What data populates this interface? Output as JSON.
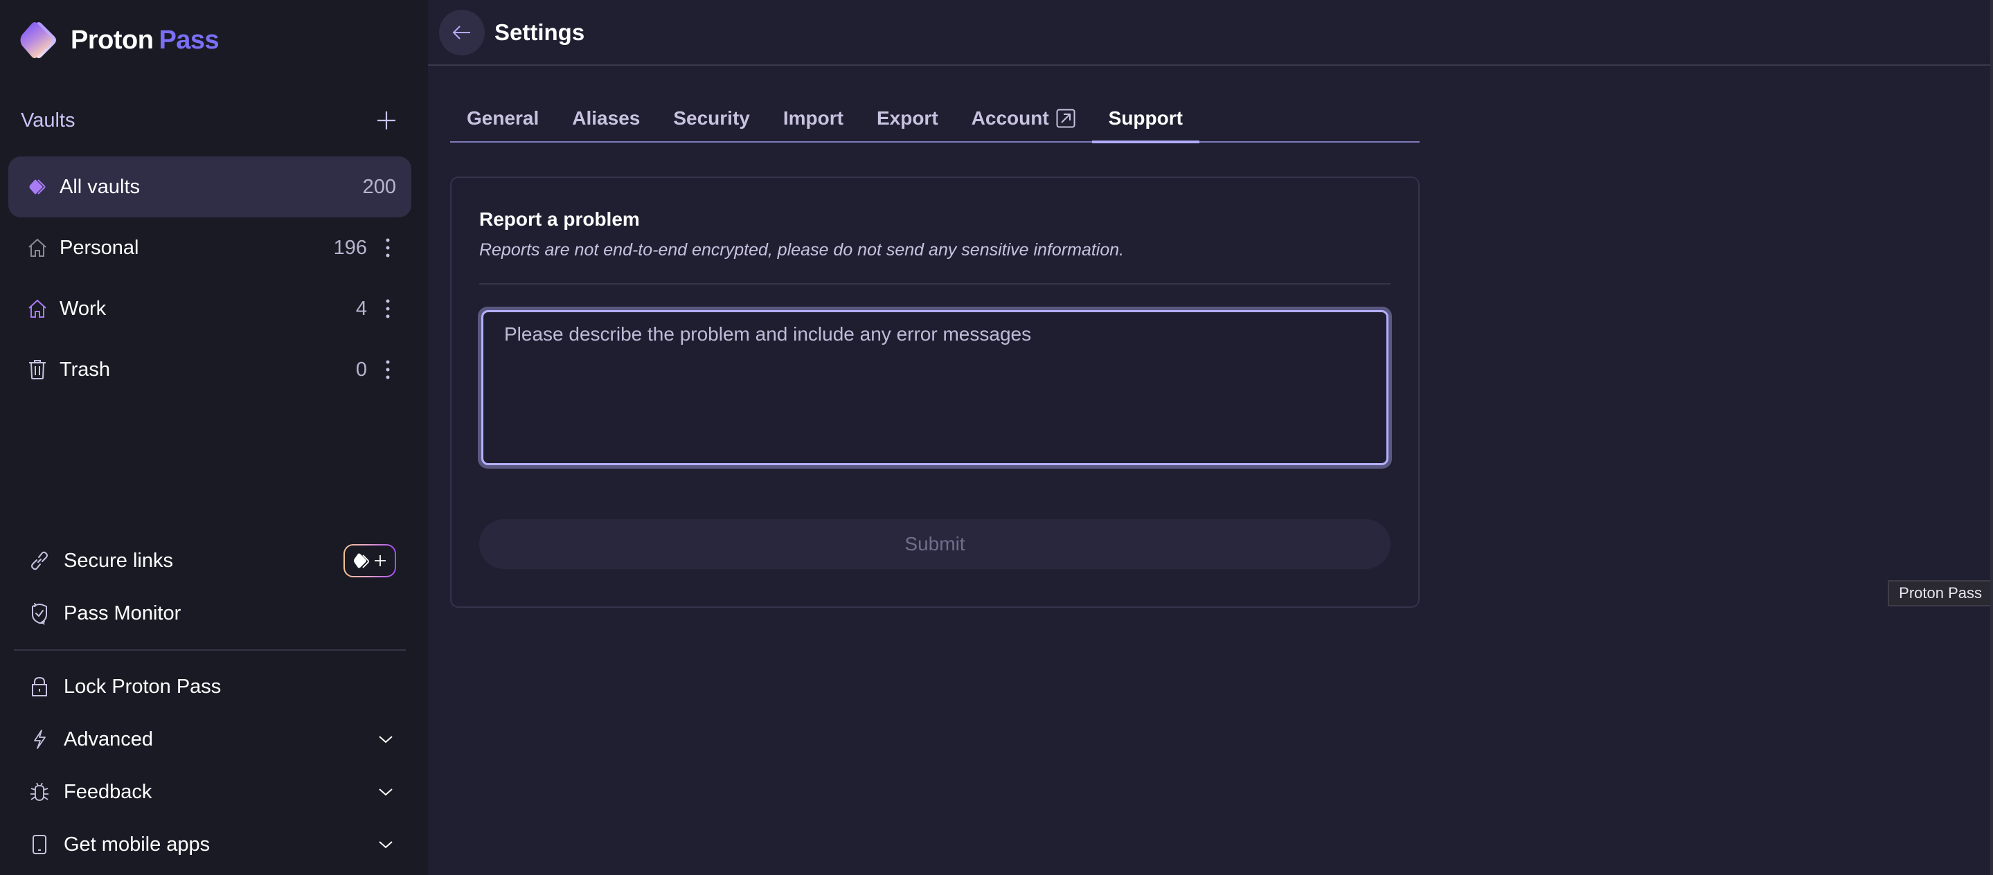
{
  "app": {
    "name_part1": "Proton",
    "name_part2": "Pass",
    "brand_color": "#7b6ff5"
  },
  "sidebar": {
    "vaults_label": "Vaults",
    "add_vault_icon": "plus-icon",
    "vaults": [
      {
        "label": "All vaults",
        "count": "200",
        "icon": "all-vaults-icon",
        "active": true
      },
      {
        "label": "Personal",
        "count": "196",
        "icon": "home-icon",
        "icon_color": "#8a8897"
      },
      {
        "label": "Work",
        "count": "4",
        "icon": "home-icon",
        "icon_color": "#a77cf5"
      },
      {
        "label": "Trash",
        "count": "0",
        "icon": "trash-icon"
      }
    ],
    "tools": [
      {
        "label": "Secure links",
        "icon": "link-icon",
        "badge": "upgrade-plus-badge"
      },
      {
        "label": "Pass Monitor",
        "icon": "shield-check-icon"
      }
    ],
    "menu": [
      {
        "label": "Lock Proton Pass",
        "icon": "lock-icon"
      },
      {
        "label": "Advanced",
        "icon": "bolt-icon",
        "expandable": true
      },
      {
        "label": "Feedback",
        "icon": "bug-icon",
        "expandable": true
      },
      {
        "label": "Get mobile apps",
        "icon": "mobile-icon",
        "expandable": true
      }
    ]
  },
  "header": {
    "back_icon": "arrow-left-icon",
    "title": "Settings"
  },
  "tabs": [
    {
      "label": "General"
    },
    {
      "label": "Aliases"
    },
    {
      "label": "Security"
    },
    {
      "label": "Import"
    },
    {
      "label": "Export"
    },
    {
      "label": "Account",
      "external": true
    },
    {
      "label": "Support",
      "active": true
    }
  ],
  "report": {
    "title": "Report a problem",
    "description": "Reports are not end-to-end encrypted, please do not send any sensitive information.",
    "placeholder": "Please describe the problem and include any error messages",
    "value": "",
    "submit_label": "Submit",
    "submit_disabled": true
  },
  "tooltip": {
    "text": "Proton Pass"
  }
}
